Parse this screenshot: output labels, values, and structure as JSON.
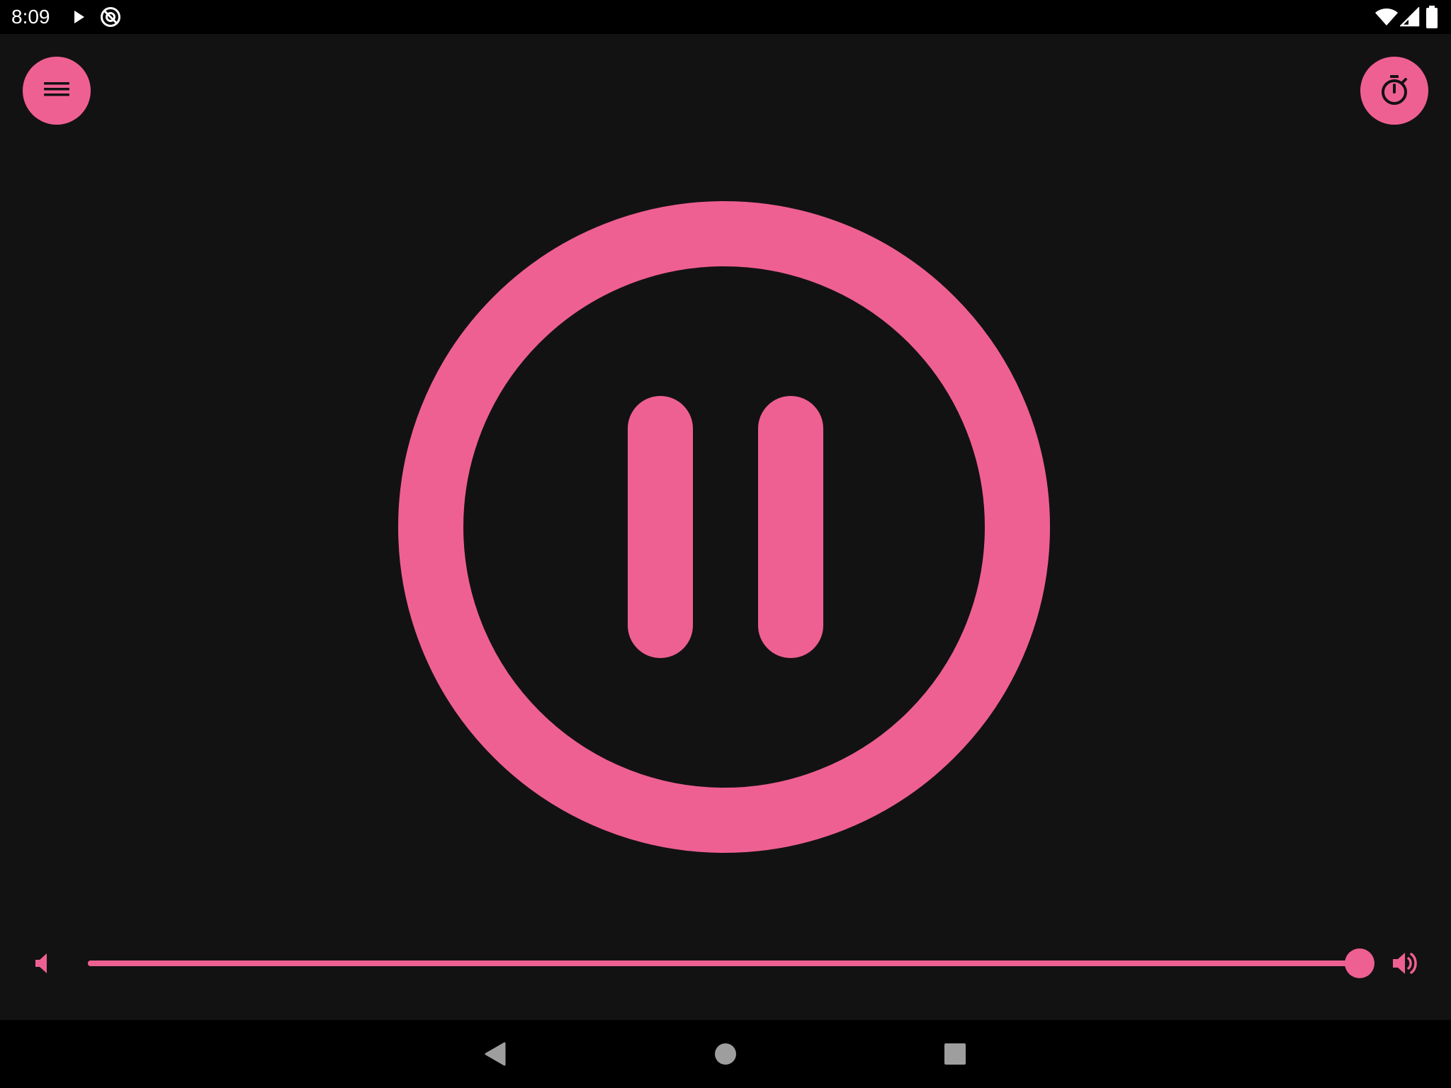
{
  "colors": {
    "accent": "#EF6092",
    "background": "#131213",
    "system_bar": "#000000",
    "on_accent": "#131213",
    "nav_icon": "#9E9E9E",
    "status_text": "#FFFFFF"
  },
  "status_bar": {
    "time": "8:09",
    "left_icons": [
      "play-notification-icon",
      "no-data-saver-icon"
    ],
    "right_icons": [
      "wifi-icon",
      "cellular-signal-icon",
      "battery-icon"
    ]
  },
  "toolbar": {
    "menu_button_icon": "menu-icon",
    "timer_button_icon": "timer-icon"
  },
  "player": {
    "state": "playing",
    "center_icon": "pause-icon"
  },
  "volume": {
    "level": 1.0,
    "min_icon": "volume-mute-icon",
    "max_icon": "volume-up-icon"
  },
  "nav_bar": {
    "buttons": [
      "back-icon",
      "home-icon",
      "recents-icon"
    ]
  }
}
